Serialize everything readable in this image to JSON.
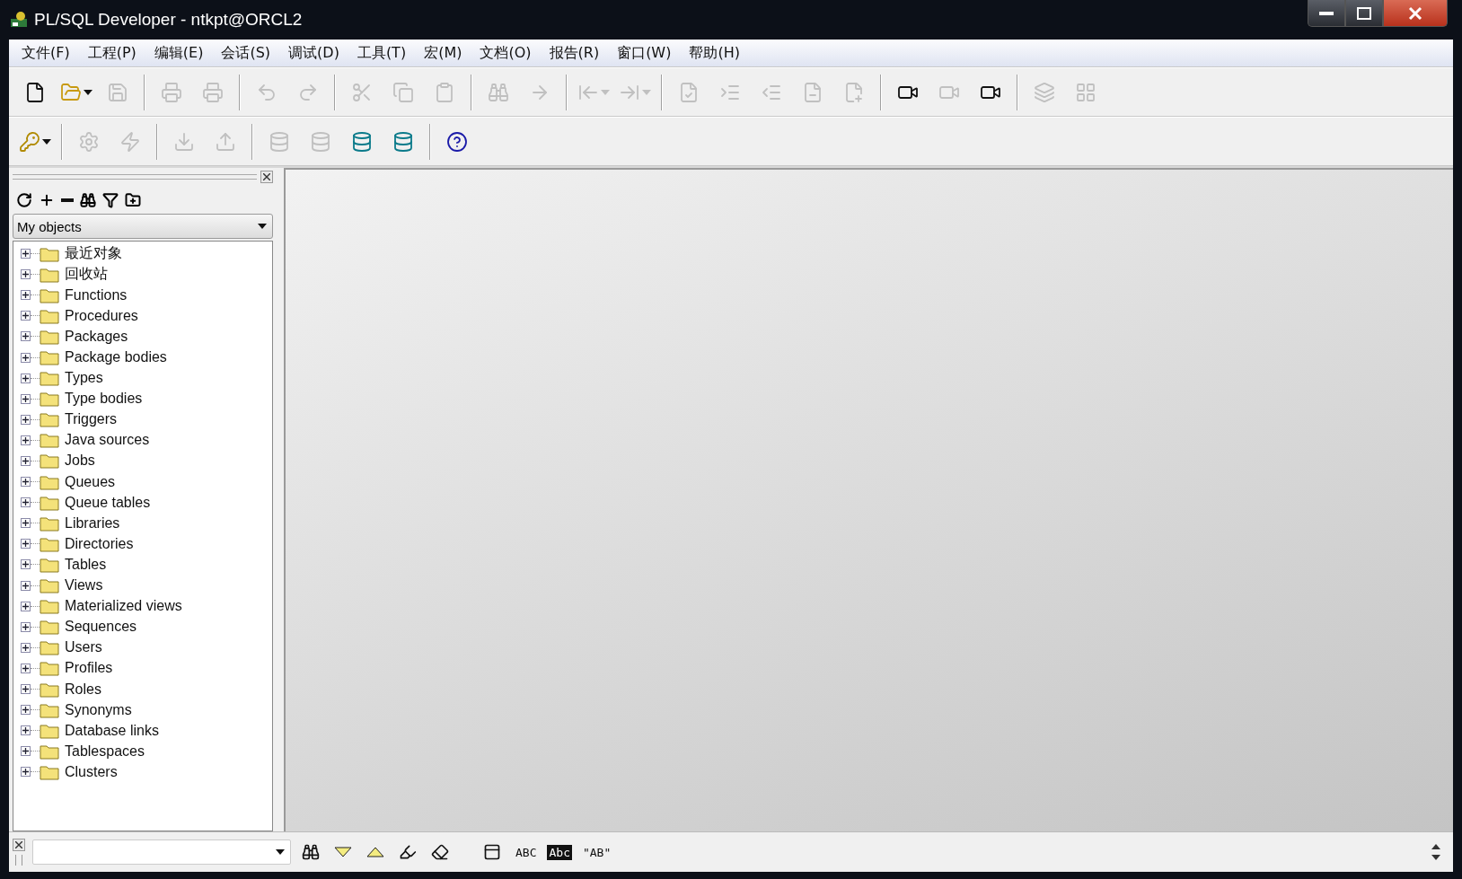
{
  "window": {
    "title": "PL/SQL Developer - ntkpt@ORCL2"
  },
  "menu": [
    "文件(F)",
    "工程(P)",
    "编辑(E)",
    "会话(S)",
    "调试(D)",
    "工具(T)",
    "宏(M)",
    "文档(O)",
    "报告(R)",
    "窗口(W)",
    "帮助(H)"
  ],
  "toolbar_1": [
    {
      "kind": "new",
      "disabled": false
    },
    {
      "kind": "open",
      "disabled": false,
      "dropdown": true
    },
    {
      "kind": "save",
      "disabled": true
    },
    {
      "kind": "sep"
    },
    {
      "kind": "print",
      "disabled": true
    },
    {
      "kind": "print",
      "disabled": true
    },
    {
      "kind": "sep"
    },
    {
      "kind": "undo",
      "disabled": true
    },
    {
      "kind": "redo",
      "disabled": true
    },
    {
      "kind": "sep"
    },
    {
      "kind": "cut",
      "disabled": true
    },
    {
      "kind": "copy",
      "disabled": true
    },
    {
      "kind": "paste",
      "disabled": true
    },
    {
      "kind": "sep"
    },
    {
      "kind": "find",
      "disabled": true
    },
    {
      "kind": "findnext",
      "disabled": true
    },
    {
      "kind": "sep"
    },
    {
      "kind": "back",
      "disabled": true,
      "dropdown": true
    },
    {
      "kind": "forward",
      "disabled": true,
      "dropdown": true
    },
    {
      "kind": "sep"
    },
    {
      "kind": "check",
      "disabled": true
    },
    {
      "kind": "indent",
      "disabled": true
    },
    {
      "kind": "outdent",
      "disabled": true
    },
    {
      "kind": "comment",
      "disabled": true
    },
    {
      "kind": "uncomment",
      "disabled": true
    },
    {
      "kind": "sep"
    },
    {
      "kind": "record",
      "disabled": false
    },
    {
      "kind": "play",
      "disabled": true
    },
    {
      "kind": "macro",
      "disabled": false
    },
    {
      "kind": "sep"
    },
    {
      "kind": "windows",
      "disabled": true
    },
    {
      "kind": "tile",
      "disabled": true
    }
  ],
  "toolbar_2": [
    {
      "kind": "key",
      "disabled": false,
      "dropdown": true
    },
    {
      "kind": "sep"
    },
    {
      "kind": "gear",
      "disabled": true
    },
    {
      "kind": "bolt",
      "disabled": true
    },
    {
      "kind": "sep"
    },
    {
      "kind": "download",
      "disabled": true
    },
    {
      "kind": "upload",
      "disabled": true
    },
    {
      "kind": "sep"
    },
    {
      "kind": "db",
      "disabled": true
    },
    {
      "kind": "dbsql",
      "disabled": true
    },
    {
      "kind": "dbfind",
      "disabled": false
    },
    {
      "kind": "dbcancel",
      "disabled": false
    },
    {
      "kind": "sep"
    },
    {
      "kind": "help",
      "disabled": false
    }
  ],
  "browser": {
    "tools": [
      {
        "kind": "refresh"
      },
      {
        "kind": "add"
      },
      {
        "kind": "remove"
      },
      {
        "kind": "find"
      },
      {
        "kind": "filter"
      },
      {
        "kind": "folder"
      }
    ],
    "filter": {
      "value": "My objects"
    },
    "tree": [
      {
        "label": "最近对象",
        "expanded": false
      },
      {
        "label": "回收站",
        "expanded": false
      },
      {
        "label": "Functions",
        "expanded": false
      },
      {
        "label": "Procedures",
        "expanded": false
      },
      {
        "label": "Packages",
        "expanded": false
      },
      {
        "label": "Package bodies",
        "expanded": false
      },
      {
        "label": "Types",
        "expanded": false
      },
      {
        "label": "Type bodies",
        "expanded": false
      },
      {
        "label": "Triggers",
        "expanded": false
      },
      {
        "label": "Java sources",
        "expanded": false
      },
      {
        "label": "Jobs",
        "expanded": false
      },
      {
        "label": "Queues",
        "expanded": false
      },
      {
        "label": "Queue tables",
        "expanded": false
      },
      {
        "label": "Libraries",
        "expanded": false
      },
      {
        "label": "Directories",
        "expanded": false
      },
      {
        "label": "Tables",
        "expanded": false
      },
      {
        "label": "Views",
        "expanded": false
      },
      {
        "label": "Materialized views",
        "expanded": false
      },
      {
        "label": "Sequences",
        "expanded": false
      },
      {
        "label": "Users",
        "expanded": false
      },
      {
        "label": "Profiles",
        "expanded": false
      },
      {
        "label": "Roles",
        "expanded": false
      },
      {
        "label": "Synonyms",
        "expanded": false
      },
      {
        "label": "Database links",
        "expanded": false
      },
      {
        "label": "Tablespaces",
        "expanded": false
      },
      {
        "label": "Clusters",
        "expanded": false
      }
    ]
  },
  "find_bar": {
    "tools": [
      {
        "kind": "find"
      },
      {
        "kind": "down"
      },
      {
        "kind": "up"
      },
      {
        "kind": "highlight"
      },
      {
        "kind": "erase"
      },
      {
        "kind": "sep"
      },
      {
        "kind": "window"
      },
      {
        "kind": "text",
        "label": "ABC"
      },
      {
        "kind": "inverse",
        "label": "Abc"
      },
      {
        "kind": "text",
        "label": "\"AB\""
      }
    ]
  }
}
